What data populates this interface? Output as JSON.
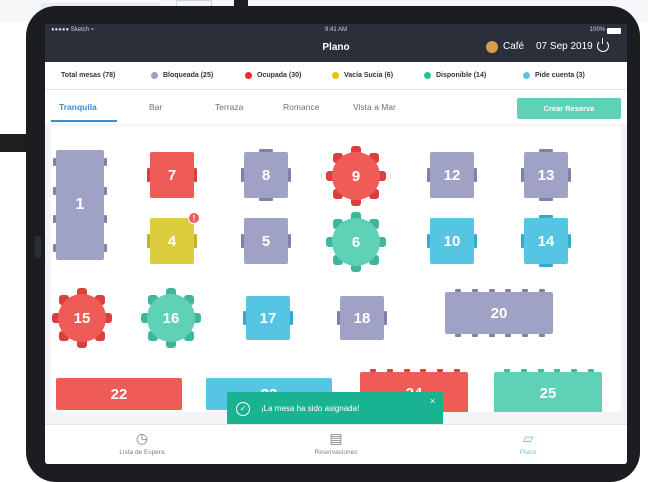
{
  "status_bar": {
    "carrier": "●●●●● Sketch ≈",
    "time": "9:41 AM",
    "battery": "100%"
  },
  "nav": {
    "title": "Plano",
    "location": "Café",
    "date": "07 Sep 2019"
  },
  "legend": [
    {
      "label": "Total mesas (78)",
      "color": ""
    },
    {
      "label": "Bloqueada (25)",
      "color": "#9fa2c4"
    },
    {
      "label": "Ocupada (30)",
      "color": "#ef2a2a"
    },
    {
      "label": "Vacía Sucia (6)",
      "color": "#e2c50f"
    },
    {
      "label": "Disponible (14)",
      "color": "#27c18f"
    },
    {
      "label": "Pide cuenta (3)",
      "color": "#55c5e3"
    }
  ],
  "tabs": [
    "Tranquila",
    "Bar",
    "Terraza",
    "Romance",
    "Vista a Mar"
  ],
  "active_tab": "Tranquila",
  "create_button": "Crear Reserva",
  "tables": [
    "1",
    "7",
    "8",
    "9",
    "12",
    "13",
    "4",
    "5",
    "6",
    "10",
    "14",
    "15",
    "16",
    "17",
    "18",
    "20",
    "22",
    "23",
    "24",
    "25"
  ],
  "alert_badge": "!",
  "toast": {
    "message": "¡La mesa ha sido asignada!",
    "check": "✓",
    "close": "×"
  },
  "tabbar": [
    {
      "label": "Lista de Espera",
      "icon": "clock-icon"
    },
    {
      "label": "Reservaciones",
      "icon": "clipboard-icon"
    },
    {
      "label": "Plano",
      "icon": "map-icon"
    }
  ],
  "colors": {
    "gray": "#9fa2c4",
    "red": "#ef5b57",
    "yellow": "#dccd3e",
    "teal": "#5fd1b6",
    "blue": "#55c5e3",
    "accent": "#3a8ccf"
  }
}
